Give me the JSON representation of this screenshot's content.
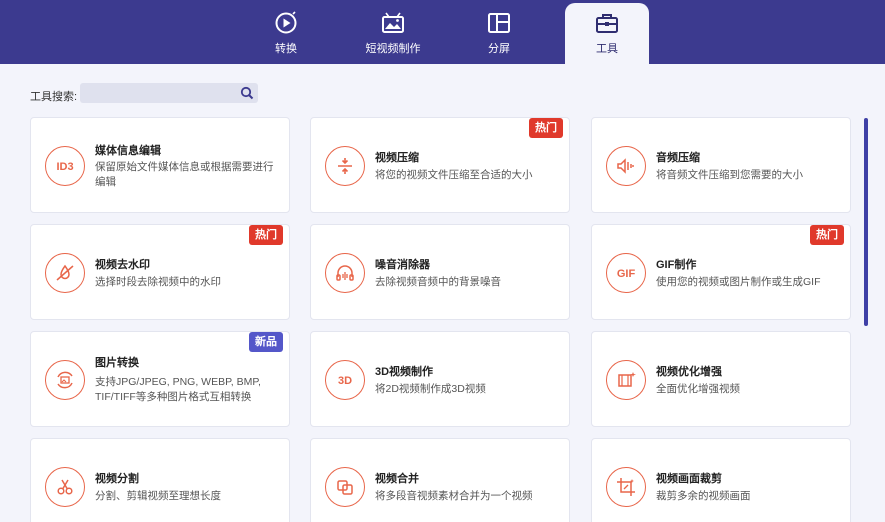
{
  "tabs": [
    {
      "label": "转换",
      "icon": "play-circle-icon"
    },
    {
      "label": "短视频制作",
      "icon": "tv-image-icon"
    },
    {
      "label": "分屏",
      "icon": "split-screen-icon"
    },
    {
      "label": "工具",
      "icon": "toolbox-icon",
      "active": true
    }
  ],
  "search": {
    "label": "工具搜索:",
    "placeholder": ""
  },
  "tools": [
    {
      "title": "媒体信息编辑",
      "desc": "保留原始文件媒体信息或根据需要进行编辑",
      "icon": "id3-icon",
      "badge": ""
    },
    {
      "title": "视频压缩",
      "desc": "将您的视频文件压缩至合适的大小",
      "icon": "compress-icon",
      "badge": "热门"
    },
    {
      "title": "音频压缩",
      "desc": "将音频文件压缩到您需要的大小",
      "icon": "audio-compress-icon",
      "badge": ""
    },
    {
      "title": "视频去水印",
      "desc": "选择时段去除视频中的水印",
      "icon": "watermark-remove-icon",
      "badge": "热门"
    },
    {
      "title": "噪音消除器",
      "desc": "去除视频音频中的背景噪音",
      "icon": "headphones-icon",
      "badge": ""
    },
    {
      "title": "GIF制作",
      "desc": "使用您的视频或图片制作或生成GIF",
      "icon": "gif-icon",
      "badge": "热门"
    },
    {
      "title": "图片转换",
      "desc": "支持JPG/JPEG, PNG, WEBP, BMP, TIF/TIFF等多种图片格式互相转换",
      "icon": "image-convert-icon",
      "badge": "新品"
    },
    {
      "title": "3D视频制作",
      "desc": "将2D视频制作成3D视频",
      "icon": "3d-icon",
      "badge": ""
    },
    {
      "title": "视频优化增强",
      "desc": "全面优化增强视频",
      "icon": "enhance-icon",
      "badge": ""
    },
    {
      "title": "视频分割",
      "desc": "分割、剪辑视频至理想长度",
      "icon": "scissors-icon",
      "badge": ""
    },
    {
      "title": "视频合并",
      "desc": "将多段音视频素材合并为一个视频",
      "icon": "merge-icon",
      "badge": ""
    },
    {
      "title": "视频画面裁剪",
      "desc": "裁剪多余的视频画面",
      "icon": "crop-icon",
      "badge": ""
    }
  ],
  "colors": {
    "header": "#3c3a8f",
    "accent": "#e8664a",
    "hot_badge": "#e0392b",
    "new_badge": "#5457c9"
  }
}
